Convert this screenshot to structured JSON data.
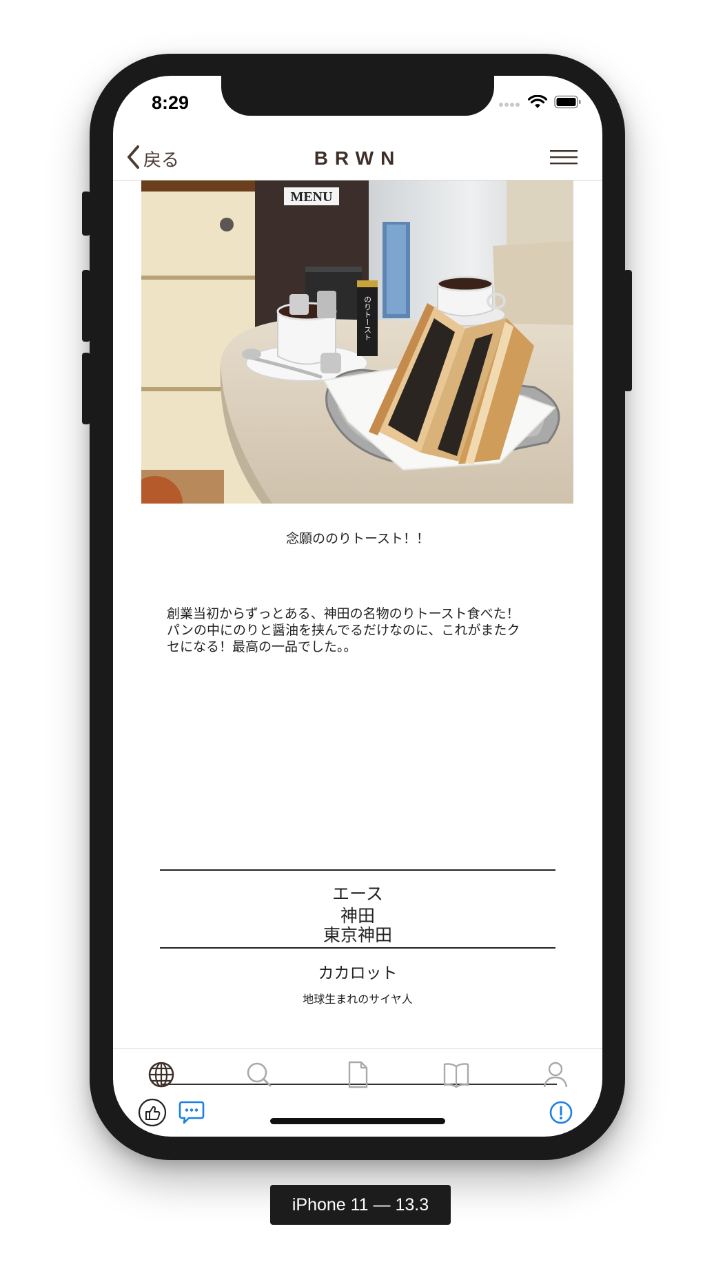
{
  "status_bar": {
    "time": "8:29"
  },
  "nav": {
    "back_label": "戻る",
    "title": "BRWN"
  },
  "post": {
    "title": "念願ののりトースト！！",
    "body_lines": [
      "創業当初からずっとある、神田の名物のりトースト食べた！",
      "パンの中にのりと醤油を挟んでるだけなのに、これがまたク",
      "セになる！最高の一品でした。。"
    ],
    "photo_sign_text": "のりトースト",
    "photo_menu_text": "MENU"
  },
  "shop": {
    "name": "エース",
    "area": "神田",
    "prefecture_area": "東京神田"
  },
  "author": {
    "name": "カカロット",
    "bio": "地球生まれのサイヤ人"
  },
  "tabbar": {
    "items": [
      "globe-icon",
      "search-icon",
      "document-icon",
      "book-icon",
      "person-icon"
    ],
    "active": "globe-icon"
  },
  "actions": [
    "like-icon",
    "comment-icon",
    "report-icon"
  ],
  "colors": {
    "brand": "#3e3029",
    "accent_blue": "#1a7fe6",
    "icon_gray": "#a9a9a9"
  },
  "device_label": "iPhone 11 — 13.3"
}
